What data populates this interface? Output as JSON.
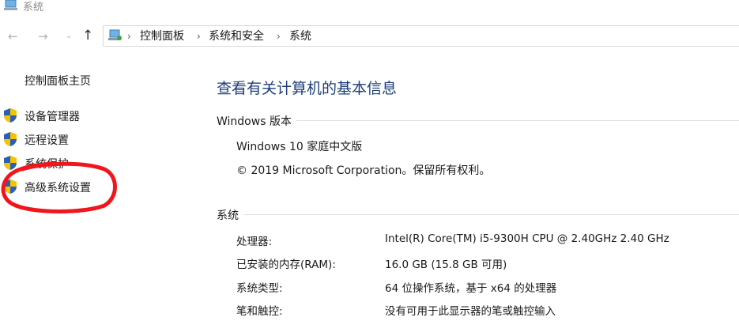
{
  "window": {
    "title": "系统"
  },
  "nav": {
    "back_glyph": "←",
    "forward_glyph": "→",
    "dropdown_glyph": "⌄",
    "up_glyph": "↑",
    "breadcrumb": [
      "控制面板",
      "系统和安全",
      "系统"
    ],
    "separator": "›"
  },
  "sidebar": {
    "home": "控制面板主页",
    "items": [
      {
        "label": "设备管理器",
        "icon": "shield-icon"
      },
      {
        "label": "远程设置",
        "icon": "shield-icon"
      },
      {
        "label": "系统保护",
        "icon": "shield-icon"
      },
      {
        "label": "高级系统设置",
        "icon": "shield-icon"
      }
    ]
  },
  "main": {
    "title": "查看有关计算机的基本信息",
    "edition_section": {
      "heading": "Windows 版本",
      "edition": "Windows 10 家庭中文版",
      "copyright": "© 2019 Microsoft Corporation。保留所有权利。"
    },
    "system_section": {
      "heading": "系统",
      "rows": [
        {
          "key": "处理器:",
          "value": "Intel(R) Core(TM) i5-9300H CPU @ 2.40GHz   2.40 GHz"
        },
        {
          "key": "已安装的内存(RAM):",
          "value": "16.0 GB (15.8 GB 可用)"
        },
        {
          "key": "系统类型:",
          "value": "64 位操作系统，基于 x64 的处理器"
        },
        {
          "key": "笔和触控:",
          "value": "没有可用于此显示器的笔或触控输入"
        }
      ]
    }
  },
  "colors": {
    "title_blue": "#1e3e7b",
    "annotation_red": "#f0161c",
    "shield_blue": "#2b5fb3",
    "shield_yellow": "#f5c400"
  }
}
